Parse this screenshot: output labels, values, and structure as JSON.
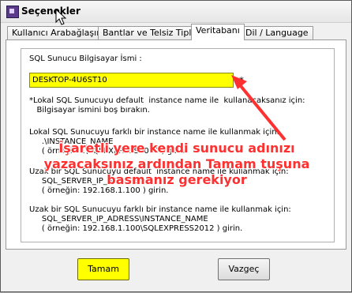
{
  "window": {
    "title": "Seçenekler"
  },
  "tabs": [
    {
      "label": "Kullanıcı Arabağlaşımı"
    },
    {
      "label": "Bantlar ve Telsiz Tipleri"
    },
    {
      "label": "Veritabanı"
    },
    {
      "label": "Dil / Language"
    }
  ],
  "form": {
    "server_label": "SQL Sunucu Bilgisayar İsmi :",
    "server_value": "DESKTOP-4U6ST10",
    "required_mark": "*",
    "info": [
      "*Lokal SQL Sunucuyu default  instance name ile  kullanacaksanız için:",
      "   Bilgisayar ismini boş bırakın.",
      "Lokal SQL Sunucuyu farklı bir instance name ile kullanmak için:",
      "     .\\INSTANCE_NAME",
      "     ( örneğin: .\\SQLEXPRESS2012 ) girin.",
      "Uzak bir SQL Sunucuyu default  instance name ile kullanmak için:",
      "     SQL_SERVER_IP_ADRESS",
      "     ( örneğin: 192.168.1.100 ) girin.",
      "Uzak bir SQL Sunucuyu farklı bir instance name ile kullanmak için:",
      "     SQL_SERVER_IP_ADRESS\\INSTANCE_NAME",
      "     ( örneğin: 192.168.1.100\\SQLEXPRESS2012 ) girin."
    ]
  },
  "annotation": {
    "lines": [
      "İşaretli yere kendi sunucu adınızı",
      "yazacaksınız ardından Tamam tuşuna",
      "basmanız gerekiyor"
    ],
    "color": "#ff3030"
  },
  "buttons": {
    "ok": "Tamam",
    "cancel": "Vazgeç"
  },
  "colors": {
    "highlight": "#ffff00"
  }
}
